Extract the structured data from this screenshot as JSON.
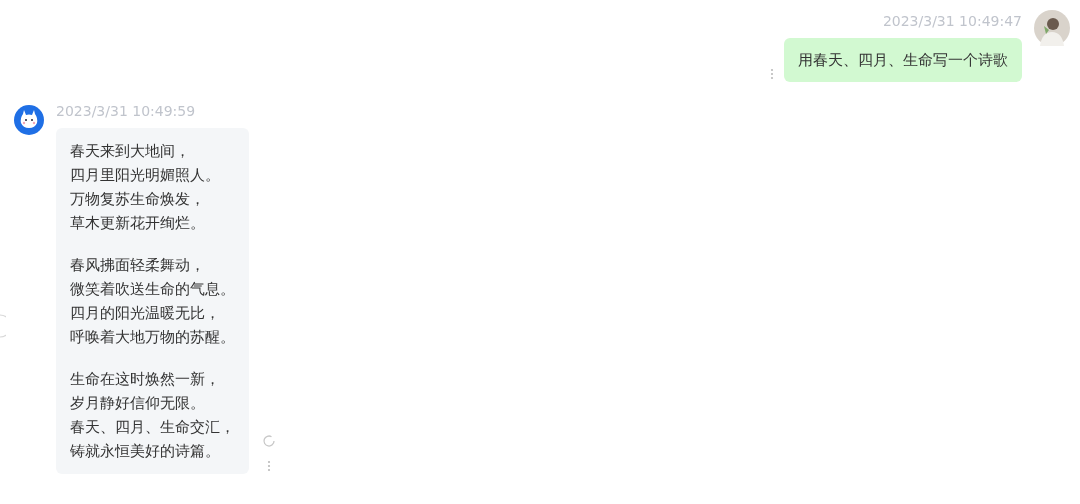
{
  "messages": [
    {
      "kind": "user",
      "time": "2023/3/31 10:49:47",
      "paragraphs": [
        [
          "用春天、四月、生命写一个诗歌"
        ]
      ]
    },
    {
      "kind": "bot",
      "time": "2023/3/31 10:49:59",
      "paragraphs": [
        [
          "春天来到大地间，",
          "四月里阳光明媚照人。",
          "万物复苏生命焕发，",
          "草木更新花开绚烂。"
        ],
        [
          "春风拂面轻柔舞动，",
          "微笑着吹送生命的气息。",
          "四月的阳光温暖无比，",
          "呼唤着大地万物的苏醒。"
        ],
        [
          "生命在这时焕然一新，",
          "岁月静好信仰无限。",
          "春天、四月、生命交汇，",
          "铸就永恒美好的诗篇。"
        ]
      ]
    }
  ]
}
